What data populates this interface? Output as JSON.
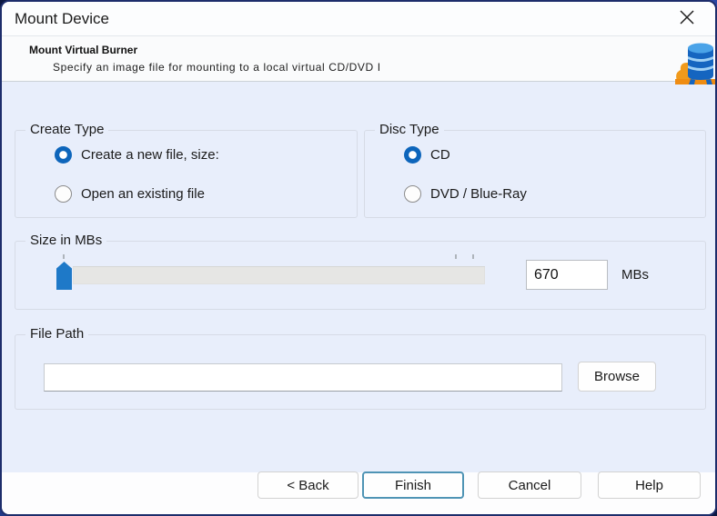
{
  "window": {
    "title": "Mount Device",
    "close_icon": "x-close"
  },
  "header": {
    "title": "Mount Virtual Burner",
    "subtitle": "Specify an image file for mounting to a local virtual CD/DVD I",
    "icon": "virtual-burner-database-icon"
  },
  "groups": {
    "create_type": {
      "label": "Create Type",
      "options": [
        {
          "label": "Create a new file, size:",
          "selected": true
        },
        {
          "label": "Open an existing file",
          "selected": false
        }
      ]
    },
    "disc_type": {
      "label": "Disc Type",
      "options": [
        {
          "label": "CD",
          "selected": true
        },
        {
          "label": "DVD / Blue-Ray",
          "selected": false
        }
      ]
    },
    "size": {
      "label": "Size in MBs",
      "value": "670",
      "unit": "MBs",
      "slider_position": "min"
    },
    "file_path": {
      "label": "File Path",
      "value": "",
      "browse_label": "Browse"
    }
  },
  "footer": {
    "buttons": [
      {
        "label": "< Back",
        "default": false
      },
      {
        "label": "Finish",
        "default": true
      },
      {
        "label": "Cancel",
        "default": false
      },
      {
        "label": "Help",
        "default": false
      }
    ]
  },
  "colors": {
    "accent_radio": "#0d65bb",
    "slider_thumb": "#1e79c8",
    "dialog_border": "#1d2d6b",
    "main_background": "#e8eefb",
    "finish_border": "#4f94b5"
  }
}
